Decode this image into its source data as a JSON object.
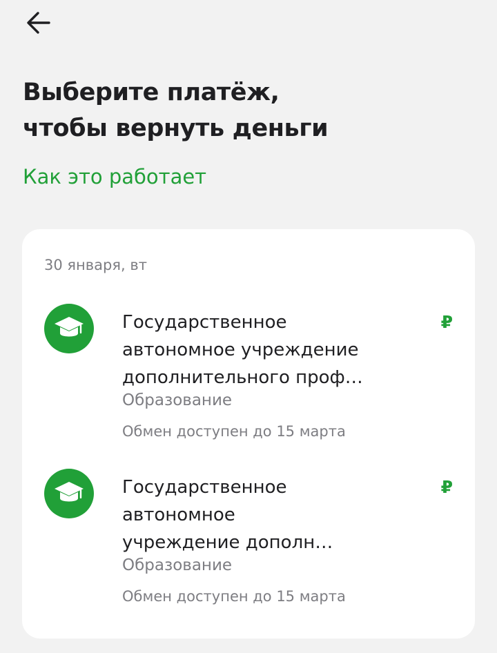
{
  "header": {
    "back_icon": "arrow-left-icon"
  },
  "page": {
    "title_line1": "Выберите платёж,",
    "title_line2": "чтобы вернуть деньги",
    "how_link": "Как это работает"
  },
  "group": {
    "date": "30 января, вт",
    "payments": [
      {
        "icon": "graduation-cap-icon",
        "merchant_line1": "Государственное",
        "merchant_line2": "автономное учреждение",
        "merchant_line3": "дополнительного проф…",
        "category": "Образование",
        "exchange_note": "Обмен доступен до 15 марта",
        "amount": "₽"
      },
      {
        "icon": "graduation-cap-icon",
        "merchant_line1": "Государственное",
        "merchant_line2": "автономное",
        "merchant_line3": "учреждение дополн…",
        "category": "Образование",
        "exchange_note": "Обмен доступен до 15 марта",
        "amount": "₽"
      }
    ]
  },
  "colors": {
    "accent": "#21a038",
    "background": "#f2f2f2",
    "card": "#ffffff",
    "text_primary": "#1f1f22",
    "text_secondary": "#7d7d82"
  }
}
